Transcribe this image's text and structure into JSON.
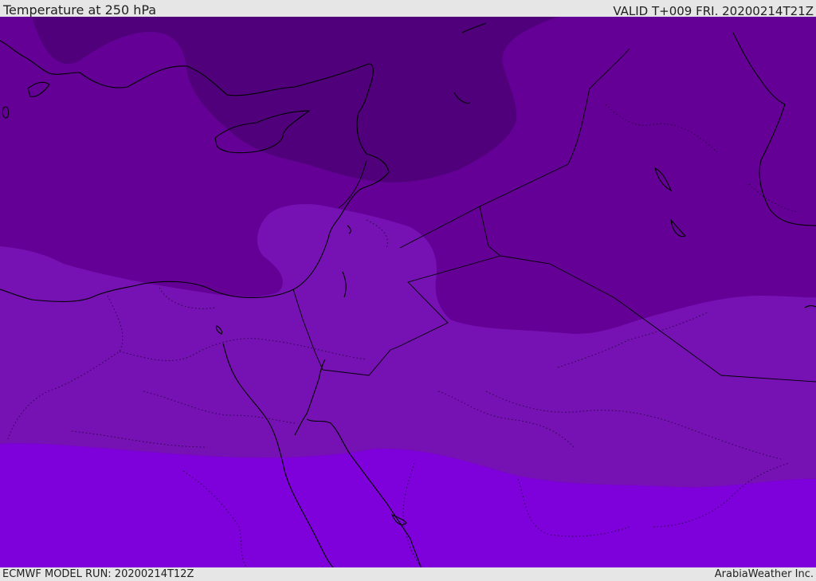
{
  "header": {
    "title": "Temperature at 250 hPa",
    "valid": "VALID T+009 FRI. 20200214T21Z"
  },
  "footer": {
    "model_run": "ECMWF MODEL RUN: 20200214T12Z",
    "brand": "ArabiaWeather Inc."
  },
  "palette": {
    "band_coldest": "#4f007a",
    "band_cold": "#640096",
    "band_mid": "#7612b3",
    "band_warm": "#7e00da",
    "coastline": "#000000"
  }
}
